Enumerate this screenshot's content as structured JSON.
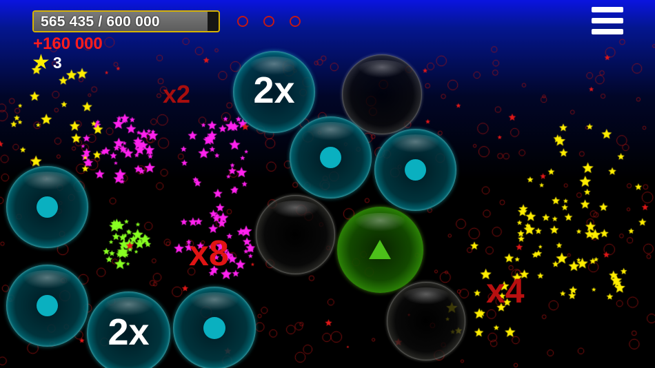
{
  "hud": {
    "score_text": "565 435 / 600 000",
    "score_progress": 0.942,
    "bonus_text": "+160 000",
    "star_count": "3",
    "lives_slots": 3
  },
  "menu": {
    "icon": "hamburger-menu-icon"
  },
  "bubbles": [
    {
      "kind": "cyan",
      "label": "",
      "icon": "dot"
    },
    {
      "kind": "cyan",
      "label": "2x",
      "icon": ""
    },
    {
      "kind": "clear",
      "label": "",
      "icon": ""
    },
    {
      "kind": "cyan",
      "label": "",
      "icon": "dot"
    },
    {
      "kind": "cyan",
      "label": "",
      "icon": "dot"
    },
    {
      "kind": "clear",
      "label": "",
      "icon": ""
    },
    {
      "kind": "green",
      "label": "",
      "icon": "triangle-up"
    },
    {
      "kind": "clear",
      "label": "",
      "icon": ""
    },
    {
      "kind": "cyan",
      "label": "",
      "icon": "dot"
    },
    {
      "kind": "cyan",
      "label": "2x",
      "icon": ""
    },
    {
      "kind": "cyan",
      "label": "",
      "icon": "dot"
    }
  ],
  "multipliers": [
    "x2",
    "x8",
    "x4"
  ],
  "colors": {
    "score_border": "#d8b400",
    "bonus": "#ff1c1c",
    "multiplier": "#cc1010",
    "cyan_bubble": "#1edceb",
    "green_bubble": "#78e61e",
    "star_yellow": "#ffee00",
    "star_magenta": "#ff22ee",
    "star_lime": "#88ff22"
  }
}
